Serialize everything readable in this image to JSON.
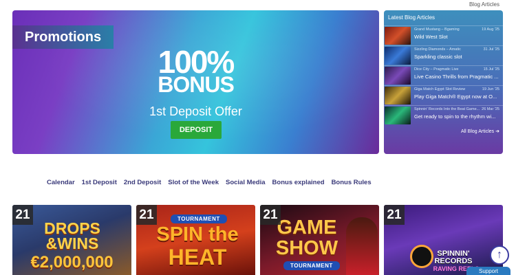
{
  "header": {
    "blog_link": "Blog Articles"
  },
  "hero": {
    "tab": "Promotions",
    "headline1": "100%",
    "headline2": "BONUS",
    "subtitle": "1st Deposit Offer",
    "button": "DEPOSIT"
  },
  "blog": {
    "title": "Latest Blog Articles",
    "items": [
      {
        "meta": "Grand Mustang – Bgaming",
        "date": "19 Aug '25",
        "title": "Wild West Slot"
      },
      {
        "meta": "Sizzling Diamonds – Amatic",
        "date": "31 Jul '25",
        "title": "Sparkling classic slot"
      },
      {
        "meta": "Dice City – Pragmatic Live",
        "date": "15 Jul '25",
        "title": "Live Casino Thrills from Pragmatic ..."
      },
      {
        "meta": "Giga Match Egypt Slot Review",
        "date": "19 Jun '25",
        "title": "Play Giga Match® Egypt now at O..."
      },
      {
        "meta": "Spinnin' Records Into the Beat Game...",
        "date": "26 Mar '25",
        "title": "Get ready to spin to the rhythm wi..."
      }
    ],
    "all_link": "All Blog Articles ➔"
  },
  "nav": [
    "Calendar",
    "1st Deposit",
    "2nd Deposit",
    "Slot of the Week",
    "Social Media",
    "Bonus explained",
    "Bonus Rules"
  ],
  "tiles": [
    {
      "num": "21",
      "line1": "DROPS",
      "line2": "&WINS",
      "line3": "€2,000,000"
    },
    {
      "num": "21",
      "badge": "TOURNAMENT",
      "line1": "SPIN the",
      "line2": "HEAT"
    },
    {
      "num": "21",
      "line1": "GAME",
      "line2": "SHOW",
      "badge": "TOURNAMENT"
    },
    {
      "num": "21",
      "line1": "SPINNIN'",
      "line2": "RECORDS",
      "line3": "RAVING REELS"
    }
  ],
  "scroll_top": "↑",
  "support": "Support"
}
